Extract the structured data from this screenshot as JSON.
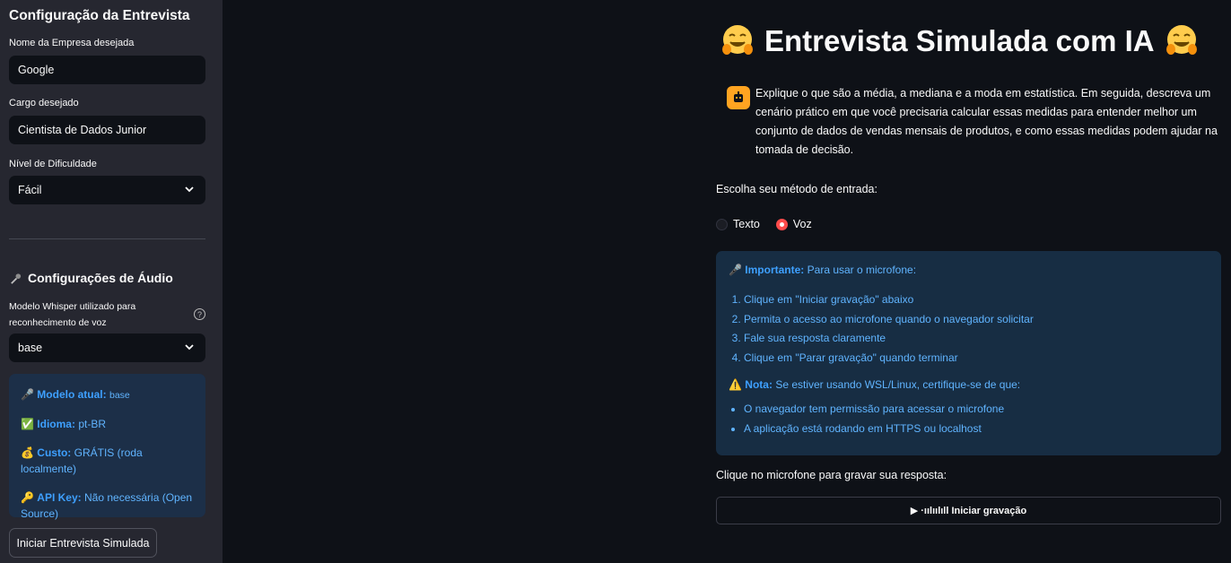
{
  "sidebar": {
    "title": "Configuração da Entrevista",
    "company_label": "Nome da Empresa desejada",
    "company_value": "Google",
    "role_label": "Cargo desejado",
    "role_value": "Cientista de Dados Junior",
    "difficulty_label": "Nível de Dificuldade",
    "difficulty_value": "Fácil",
    "audio_title": "Configurações de Áudio",
    "whisper_label": "Modelo Whisper utilizado para reconhecimento de voz",
    "whisper_value": "base",
    "info": {
      "model_label": "Modelo atual:",
      "model_value": "base",
      "lang_label": "Idioma:",
      "lang_value": "pt-BR",
      "cost_label": "Custo:",
      "cost_value": "GRÁTIS (roda localmente)",
      "api_label": "API Key:",
      "api_value": "Não necessária (Open Source)"
    },
    "start_button": "Iniciar Entrevista Simulada"
  },
  "main": {
    "title": "Entrevista Simulada com IA",
    "question": "Explique o que são a média, a mediana e a moda em estatística. Em seguida, descreva um cenário prático em que você precisaria calcular essas medidas para entender melhor um conjunto de dados de vendas mensais de produtos, e como essas medidas podem ajudar na tomada de decisão.",
    "entry_method_label": "Escolha seu método de entrada:",
    "radio_options": [
      "Texto",
      "Voz"
    ],
    "selected_option": "Voz",
    "notice": {
      "important_label": "Importante:",
      "important_text": "Para usar o microfone:",
      "steps": [
        "Clique em \"Iniciar gravação\" abaixo",
        "Permita o acesso ao microfone quando o navegador solicitar",
        "Fale sua resposta claramente",
        "Clique em \"Parar gravação\" quando terminar"
      ],
      "nota_label": "Nota:",
      "nota_text": "Se estiver usando WSL/Linux, certifique-se de que:",
      "bullets": [
        "O navegador tem permissão para acessar o microfone",
        "A aplicação está rodando em HTTPS ou localhost"
      ]
    },
    "mic_label": "Clique no microfone para gravar sua resposta:",
    "record_button": "▶ ·ıılıılıll Iniciar gravação"
  },
  "colors": {
    "background": "#0e1117",
    "sidebar": "#262730",
    "accent": "#ff4b4b",
    "info_blue": "#60b4ff"
  },
  "icons": [
    "hugging-face-emoji",
    "robot-avatar",
    "microphone-icon",
    "check-icon",
    "money-bag-icon",
    "key-icon",
    "warning-icon",
    "chevron-down-icon",
    "help-icon"
  ]
}
